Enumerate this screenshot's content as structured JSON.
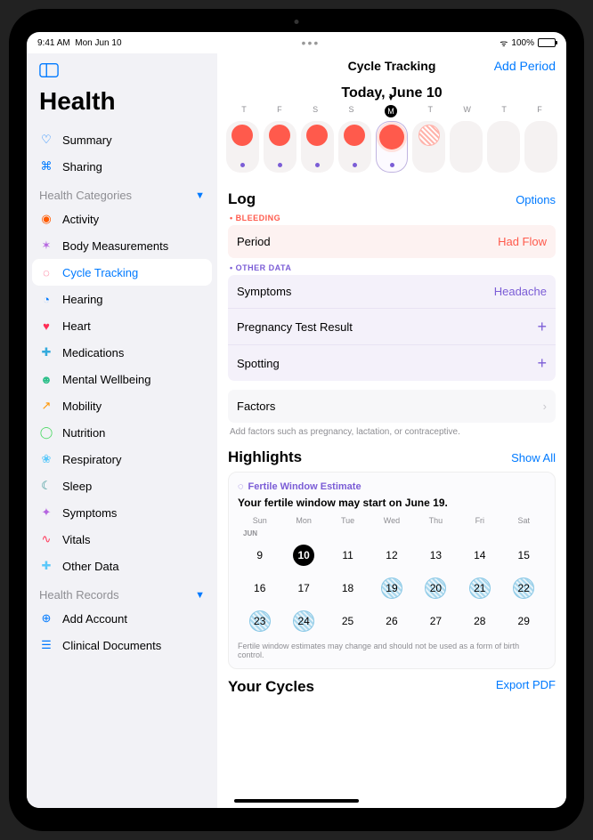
{
  "status": {
    "time": "9:41 AM",
    "date": "Mon Jun 10",
    "battery": "100%"
  },
  "sidebar": {
    "title": "Health",
    "top": [
      {
        "label": "Summary",
        "icon": "summary"
      },
      {
        "label": "Sharing",
        "icon": "sharing"
      }
    ],
    "section_categories": "Health Categories",
    "categories": [
      {
        "label": "Activity",
        "icon": "activity"
      },
      {
        "label": "Body Measurements",
        "icon": "body"
      },
      {
        "label": "Cycle Tracking",
        "icon": "cycle",
        "active": true
      },
      {
        "label": "Hearing",
        "icon": "hearing"
      },
      {
        "label": "Heart",
        "icon": "heart"
      },
      {
        "label": "Medications",
        "icon": "meds"
      },
      {
        "label": "Mental Wellbeing",
        "icon": "mental"
      },
      {
        "label": "Mobility",
        "icon": "mobility"
      },
      {
        "label": "Nutrition",
        "icon": "nutrition"
      },
      {
        "label": "Respiratory",
        "icon": "respiratory"
      },
      {
        "label": "Sleep",
        "icon": "sleep"
      },
      {
        "label": "Symptoms",
        "icon": "symptoms"
      },
      {
        "label": "Vitals",
        "icon": "vitals"
      },
      {
        "label": "Other Data",
        "icon": "other"
      }
    ],
    "section_records": "Health Records",
    "records": [
      {
        "label": "Add Account",
        "icon": "add"
      },
      {
        "label": "Clinical Documents",
        "icon": "clinical"
      }
    ]
  },
  "main": {
    "title": "Cycle Tracking",
    "add_period": "Add Period",
    "today": "Today, June 10",
    "day_labels": [
      "T",
      "F",
      "S",
      "S",
      "M",
      "T",
      "W",
      "T",
      "F"
    ],
    "days": [
      {
        "flow": true,
        "symptom": true
      },
      {
        "flow": true,
        "symptom": true
      },
      {
        "flow": true,
        "symptom": true
      },
      {
        "flow": true,
        "symptom": true
      },
      {
        "flow": true,
        "symptom": true,
        "today": true
      },
      {
        "hatch": true
      },
      {},
      {},
      {}
    ]
  },
  "log": {
    "title": "Log",
    "options": "Options",
    "bleeding_label": "BLEEDING",
    "period_label": "Period",
    "period_value": "Had Flow",
    "other_label": "OTHER DATA",
    "rows": [
      {
        "label": "Symptoms",
        "value": "Headache",
        "type": "val"
      },
      {
        "label": "Pregnancy Test Result",
        "type": "plus"
      },
      {
        "label": "Spotting",
        "type": "plus"
      }
    ],
    "factors_label": "Factors",
    "factors_hint": "Add factors such as pregnancy, lactation, or contraceptive."
  },
  "highlights": {
    "title": "Highlights",
    "show_all": "Show All",
    "badge": "Fertile Window Estimate",
    "msg": "Your fertile window may start on June 19.",
    "weekdays": [
      "Sun",
      "Mon",
      "Tue",
      "Wed",
      "Thu",
      "Fri",
      "Sat"
    ],
    "month": "JUN",
    "grid": [
      [
        {
          "n": 9
        },
        {
          "n": 10,
          "today": true
        },
        {
          "n": 11
        },
        {
          "n": 12
        },
        {
          "n": 13
        },
        {
          "n": 14
        },
        {
          "n": 15
        }
      ],
      [
        {
          "n": 16
        },
        {
          "n": 17
        },
        {
          "n": 18
        },
        {
          "n": 19,
          "f": true
        },
        {
          "n": 20,
          "f": true
        },
        {
          "n": 21,
          "f": true
        },
        {
          "n": 22,
          "f": true
        }
      ],
      [
        {
          "n": 23,
          "f": true
        },
        {
          "n": 24,
          "f": true
        },
        {
          "n": 25
        },
        {
          "n": 26
        },
        {
          "n": 27
        },
        {
          "n": 28
        },
        {
          "n": 29
        }
      ]
    ],
    "footer": "Fertile window estimates may change and should not be used as a form of birth control."
  },
  "cycles": {
    "title": "Your Cycles",
    "export": "Export PDF"
  },
  "icon_colors": {
    "summary": "#007aff",
    "sharing": "#007aff",
    "activity": "#ff5a00",
    "body": "#b565e0",
    "cycle": "#ff3b6b",
    "hearing": "#007aff",
    "heart": "#ff2d55",
    "meds": "#34aadc",
    "mental": "#2dbf8a",
    "mobility": "#ff9500",
    "nutrition": "#4cd964",
    "respiratory": "#5ac8fa",
    "sleep": "#2d8f8f",
    "symptoms": "#b565e0",
    "vitals": "#ff3b5c",
    "other": "#5ac8fa",
    "add": "#007aff",
    "clinical": "#007aff"
  },
  "icon_glyphs": {
    "summary": "♡",
    "sharing": "⌘",
    "activity": "◉",
    "body": "✶",
    "cycle": "◌",
    "hearing": "◔",
    "heart": "♥",
    "meds": "✚",
    "mental": "☻",
    "mobility": "↗",
    "nutrition": "◯",
    "respiratory": "❀",
    "sleep": "☾",
    "symptoms": "✦",
    "vitals": "∿",
    "other": "✚",
    "add": "⊕",
    "clinical": "☰"
  }
}
